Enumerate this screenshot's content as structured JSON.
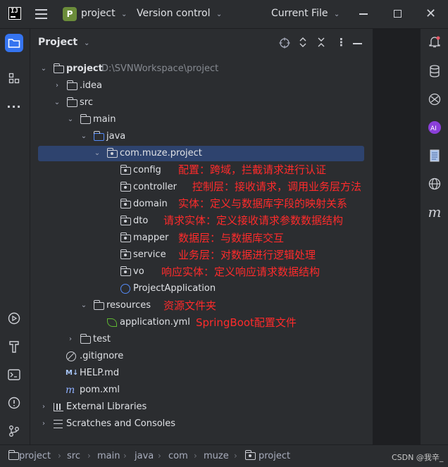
{
  "titlebar": {
    "menu_icon": "hamburger-menu-icon",
    "project_badge": "P",
    "project_name": "project",
    "vcs_label": "Version control",
    "run_config": "Current File",
    "logo_text": "IJ"
  },
  "panel": {
    "title": "Project"
  },
  "tree": {
    "root_name": "project",
    "root_path": "D:\\SVNWorkspace\\project",
    "idea": ".idea",
    "src": "src",
    "main": "main",
    "java": "java",
    "package": "com.muze.project",
    "config": "config",
    "controller": "controller",
    "domain": "domain",
    "dto": "dto",
    "mapper": "mapper",
    "service": "service",
    "vo": "vo",
    "app_class": "ProjectApplication",
    "resources": "resources",
    "app_yml": "application.yml",
    "test": "test",
    "gitignore": ".gitignore",
    "help_md": "HELP.md",
    "md_prefix": "M↓",
    "pom": "pom.xml",
    "ext_libs": "External Libraries",
    "scratches": "Scratches and Consoles"
  },
  "notes": {
    "config": "配置：跨域，拦截请求进行认证",
    "controller": "控制层：接收请求，调用业务层方法",
    "domain": "实体：定义与数据库字段的映射关系",
    "dto": "请求实体：定义接收请求参数数据结构",
    "mapper": "数据层：与数据库交互",
    "service": "业务层：对数据进行逻辑处理",
    "vo": "响应实体：定义响应请求数据结构",
    "resources": "资源文件夹",
    "app_yml": "SpringBoot配置文件"
  },
  "breadcrumbs": [
    "project",
    "src",
    "main",
    "java",
    "com",
    "muze",
    "project"
  ],
  "watermark": "CSDN @我辛_",
  "colors": {
    "accent": "#3574f0",
    "annotation": "#ff2b2b",
    "selection": "#2e436e",
    "project_badge": "#6b8c3a"
  }
}
